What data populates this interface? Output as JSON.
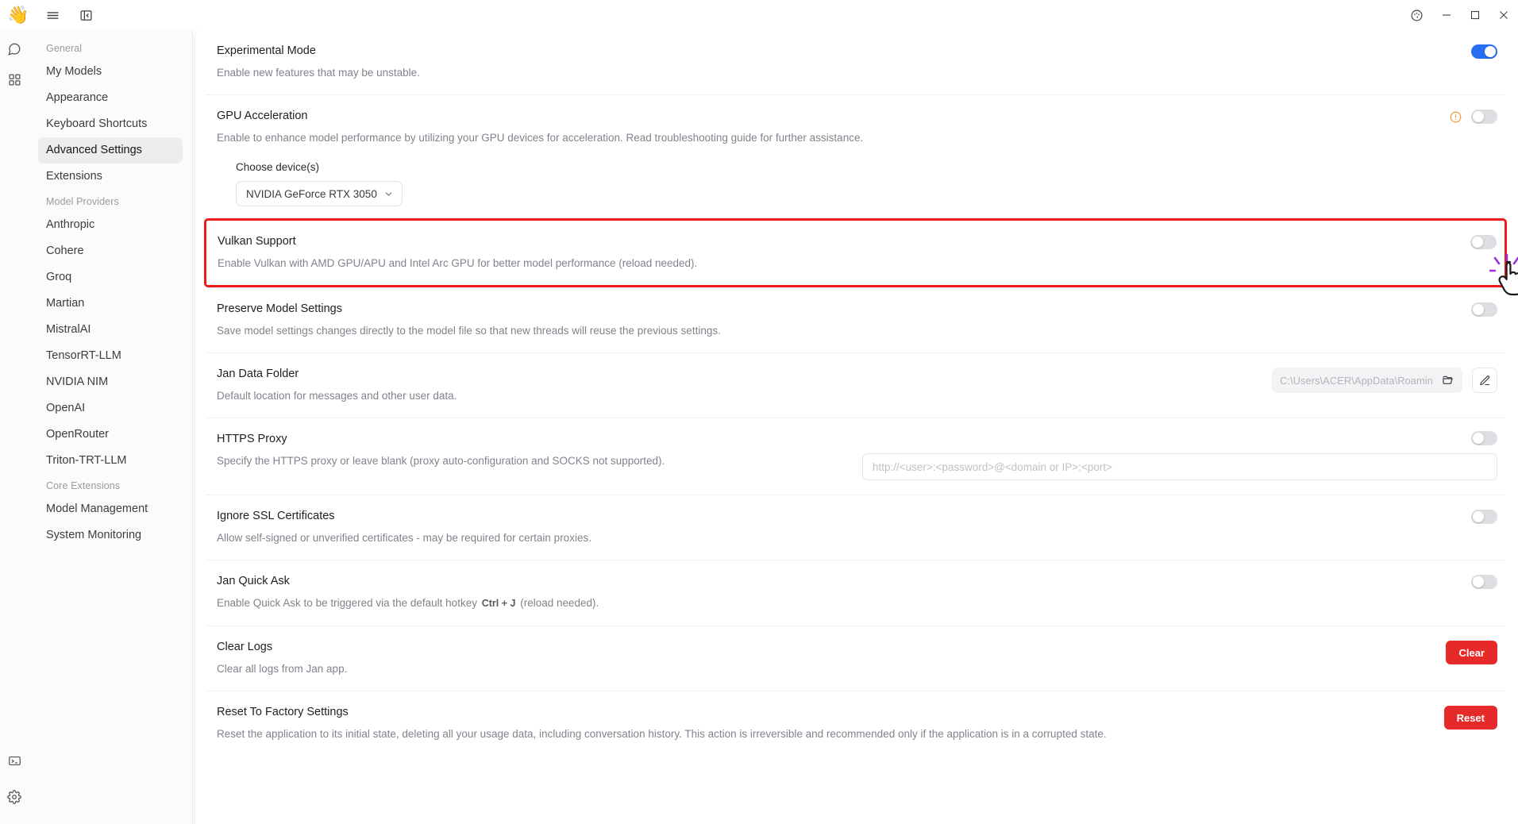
{
  "titlebar": {
    "logo_icon": "waving-hand-logo",
    "menu_icon": "hamburger-menu-icon",
    "panel_icon": "toggle-left-panel-icon",
    "palette_icon": "color-palette-icon",
    "minimize_label": "–",
    "maximize_label": "□",
    "close_label": "✕"
  },
  "rail": {
    "chat_icon": "chat-bubble-icon",
    "grid_icon": "grid-apps-icon",
    "terminal_icon": "terminal-icon",
    "settings_icon": "gear-settings-icon"
  },
  "sidebar": {
    "groups": [
      {
        "label": "General",
        "items": [
          {
            "label": "My Models",
            "active": false
          },
          {
            "label": "Appearance",
            "active": false
          },
          {
            "label": "Keyboard Shortcuts",
            "active": false
          },
          {
            "label": "Advanced Settings",
            "active": true
          },
          {
            "label": "Extensions",
            "active": false
          }
        ]
      },
      {
        "label": "Model Providers",
        "items": [
          {
            "label": "Anthropic",
            "active": false
          },
          {
            "label": "Cohere",
            "active": false
          },
          {
            "label": "Groq",
            "active": false
          },
          {
            "label": "Martian",
            "active": false
          },
          {
            "label": "MistralAI",
            "active": false
          },
          {
            "label": "TensorRT-LLM",
            "active": false
          },
          {
            "label": "NVIDIA NIM",
            "active": false
          },
          {
            "label": "OpenAI",
            "active": false
          },
          {
            "label": "OpenRouter",
            "active": false
          },
          {
            "label": "Triton-TRT-LLM",
            "active": false
          }
        ]
      },
      {
        "label": "Core Extensions",
        "items": [
          {
            "label": "Model Management",
            "active": false
          },
          {
            "label": "System Monitoring",
            "active": false
          }
        ]
      }
    ]
  },
  "settings": {
    "experimental_mode": {
      "title": "Experimental Mode",
      "desc": "Enable new features that may be unstable.",
      "toggle_state": "on"
    },
    "gpu_acceleration": {
      "title": "GPU Acceleration",
      "desc": "Enable to enhance model performance by utilizing your GPU devices for acceleration. Read troubleshooting guide for further assistance.",
      "toggle_state": "off",
      "warning_icon": "alert-circle-icon",
      "device_label": "Choose device(s)",
      "device_value": "NVIDIA GeForce RTX 3050",
      "device_chevron_icon": "chevron-down-icon"
    },
    "vulkan_support": {
      "title": "Vulkan Support",
      "desc": "Enable Vulkan with AMD GPU/APU and Intel Arc GPU for better model performance (reload needed).",
      "toggle_state": "off",
      "highlight_color": "#ee1b1b"
    },
    "preserve_model_settings": {
      "title": "Preserve Model Settings",
      "desc": "Save model settings changes directly to the model file so that new threads will reuse the previous settings.",
      "toggle_state": "off"
    },
    "jan_data_folder": {
      "title": "Jan Data Folder",
      "desc": "Default location for messages and other user data.",
      "path_value": "C:\\Users\\ACER\\AppData\\Roamin",
      "folder_icon": "folder-open-icon",
      "edit_icon": "pencil-edit-icon"
    },
    "https_proxy": {
      "title": "HTTPS Proxy",
      "desc": "Specify the HTTPS proxy or leave blank (proxy auto-configuration and SOCKS not supported).",
      "toggle_state": "off",
      "input_value": "",
      "input_placeholder": "http://<user>:<password>@<domain or IP>:<port>"
    },
    "ignore_ssl": {
      "title": "Ignore SSL Certificates",
      "desc": "Allow self-signed or unverified certificates - may be required for certain proxies.",
      "toggle_state": "off"
    },
    "jan_quick_ask": {
      "title": "Jan Quick Ask",
      "desc_before": "Enable Quick Ask to be triggered via the default hotkey",
      "hotkey": "Ctrl + J",
      "desc_after": "(reload needed).",
      "toggle_state": "off"
    },
    "clear_logs": {
      "title": "Clear Logs",
      "desc": "Clear all logs from Jan app.",
      "button_label": "Clear",
      "button_color": "#e62a2a"
    },
    "reset_factory": {
      "title": "Reset To Factory Settings",
      "desc": "Reset the application to its initial state, deleting all your usage data, including conversation history. This action is irreversible and recommended only if the application is in a corrupted state.",
      "button_label": "Reset",
      "button_color": "#e62a2a"
    }
  },
  "cursor": {
    "icon": "pointing-hand-cursor-click",
    "accent": "#9b30d9"
  }
}
